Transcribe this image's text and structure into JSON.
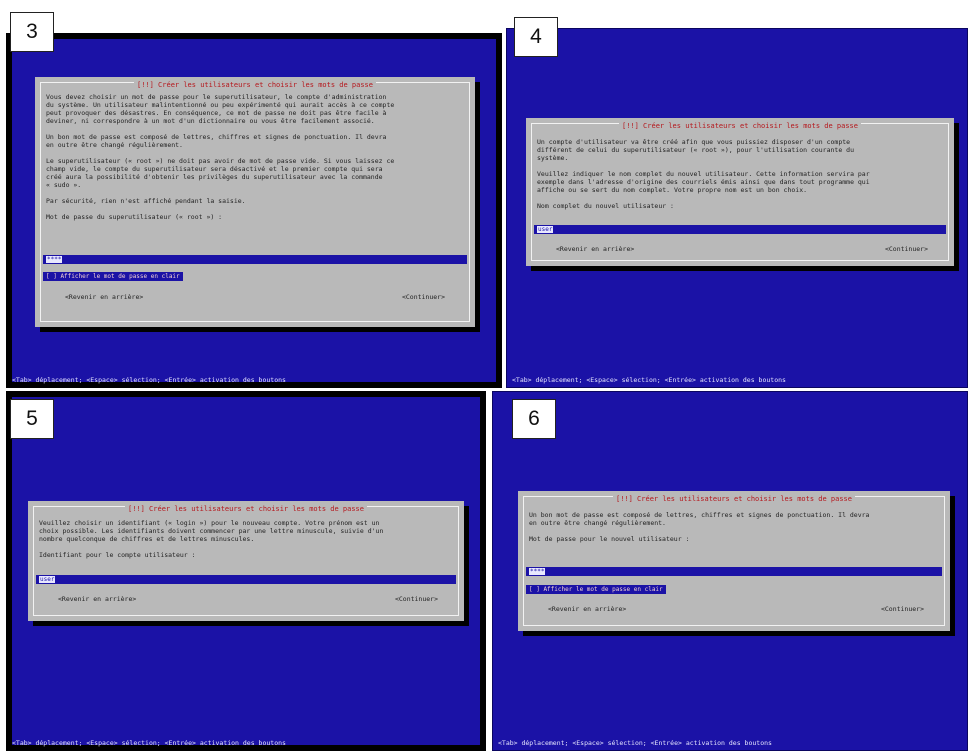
{
  "dialog_title": "[!!] Créer les utilisateurs et choisir les mots de passe",
  "status_bar": "<Tab> déplacement; <Espace> sélection; <Entrée> activation des boutons",
  "btn_back": "<Revenir en arrière>",
  "btn_continue": "<Continuer>",
  "panels": {
    "p3": {
      "step": "3",
      "text": "Vous devez choisir un mot de passe pour le superutilisateur, le compte d'administration\ndu système. Un utilisateur malintentionné ou peu expérimenté qui aurait accès à ce compte\npeut provoquer des désastres. En conséquence, ce mot de passe ne doit pas être facile à\ndeviner, ni correspondre à un mot d'un dictionnaire ou vous être facilement associé.\n\nUn bon mot de passe est composé de lettres, chiffres et signes de ponctuation. Il devra\nen outre être changé régulièrement.\n\nLe superutilisateur (« root ») ne doit pas avoir de mot de passe vide. Si vous laissez ce\nchamp vide, le compte du superutilisateur sera désactivé et le premier compte qui sera\ncréé aura la possibilité d'obtenir les privilèges du superutilisateur avec la commande\n« sudo ».\n\nPar sécurité, rien n'est affiché pendant la saisie.\n\nMot de passe du superutilisateur (« root ») :",
      "field_value": "****",
      "checkbox": "[ ] Afficher le mot de passe en clair"
    },
    "p4": {
      "step": "4",
      "text": "Un compte d'utilisateur va être créé afin que vous puissiez disposer d'un compte\ndifférent de celui du superutilisateur (« root »), pour l'utilisation courante du\nsystème.\n\nVeuillez indiquer le nom complet du nouvel utilisateur. Cette information servira par\nexemple dans l'adresse d'origine des courriels émis ainsi que dans tout programme qui\naffiche ou se sert du nom complet. Votre propre nom est un bon choix.\n\nNom complet du nouvel utilisateur :",
      "field_value": "user"
    },
    "p5": {
      "step": "5",
      "text": "Veuillez choisir un identifiant (« login ») pour le nouveau compte. Votre prénom est un\nchoix possible. Les identifiants doivent commencer par une lettre minuscule, suivie d'un\nnombre quelconque de chiffres et de lettres minuscules.\n\nIdentifiant pour le compte utilisateur :",
      "field_value": "user"
    },
    "p6": {
      "step": "6",
      "text": "Un bon mot de passe est composé de lettres, chiffres et signes de ponctuation. Il devra\nen outre être changé régulièrement.\n\nMot de passe pour le nouvel utilisateur :",
      "field_value": "****",
      "checkbox": "[ ] Afficher le mot de passe en clair"
    }
  },
  "colors": {
    "screen_blue": "#1b12a6",
    "dialog_gray": "#b9b9b9",
    "title_red": "#b5171c"
  }
}
